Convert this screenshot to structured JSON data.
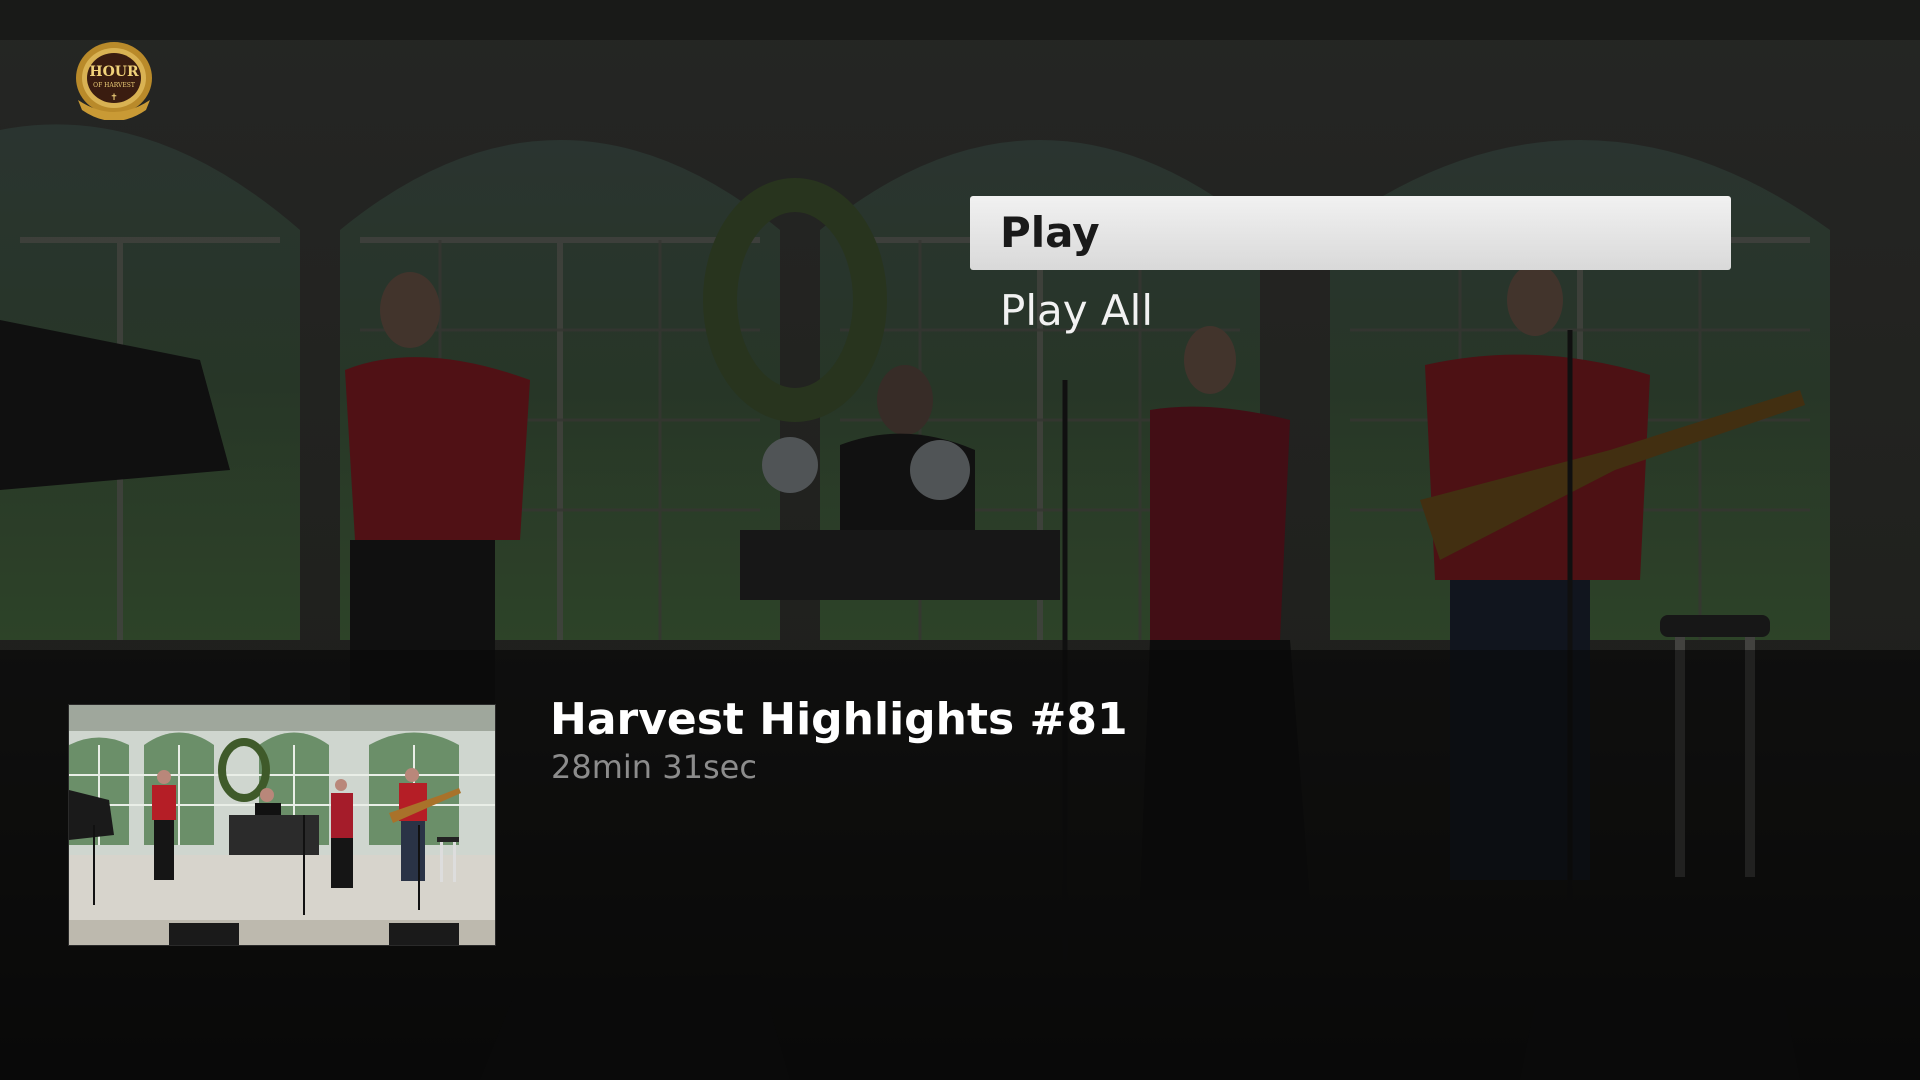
{
  "channel": {
    "logo_line1": "HOUR",
    "logo_line2": "OF HARVEST"
  },
  "menu": {
    "items": [
      {
        "label": "Play",
        "focused": true
      },
      {
        "label": "Play All",
        "focused": false
      }
    ]
  },
  "episode": {
    "title": "Harvest Highlights #81",
    "duration": "28min 31sec"
  },
  "colors": {
    "focus_bg": "#e6e6e6",
    "shirt_red": "#8a1a1f",
    "duration_gray": "#8c8c8c"
  }
}
